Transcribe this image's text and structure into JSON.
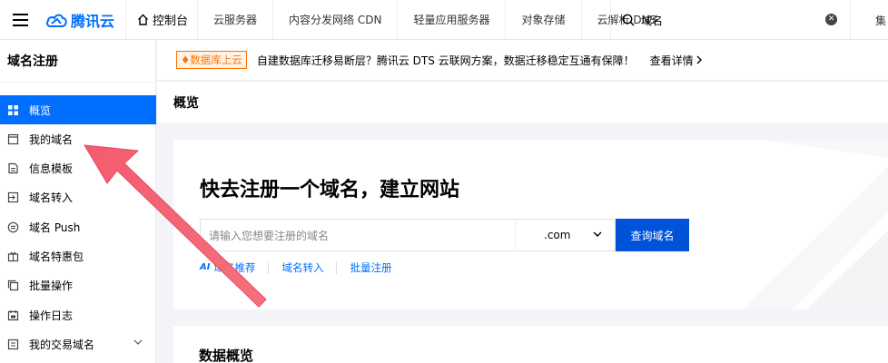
{
  "header": {
    "logo_text": "腾讯云",
    "console": "控制台",
    "nav": [
      "云服务器",
      "内容分发网络 CDN",
      "轻量应用服务器",
      "对象存储",
      "云解析 DNS"
    ],
    "search_value": "域名",
    "right_text": "集"
  },
  "sidebar": {
    "title": "域名注册",
    "items": [
      {
        "label": "概览",
        "icon": "grid-icon",
        "active": true
      },
      {
        "label": "我的域名",
        "icon": "window-icon"
      },
      {
        "label": "信息模板",
        "icon": "document-icon"
      },
      {
        "label": "域名转入",
        "icon": "transfer-icon"
      },
      {
        "label": "域名 Push",
        "icon": "push-icon"
      },
      {
        "label": "域名特惠包",
        "icon": "gift-icon"
      },
      {
        "label": "批量操作",
        "icon": "copy-icon"
      },
      {
        "label": "操作日志",
        "icon": "calendar-icon"
      },
      {
        "label": "我的交易域名",
        "icon": "trade-icon"
      }
    ]
  },
  "notice": {
    "tag": "数据库上云",
    "text": "自建数据库迁移易断层？腾讯云 DTS 云联网方案，数据迁移稳定互通有保障！",
    "link": "查看详情"
  },
  "content": {
    "header": "概览",
    "register": {
      "title": "快去注册一个域名，建立网站",
      "placeholder": "请输入您想要注册的域名",
      "tld": ".com",
      "button": "查询域名",
      "links": [
        "域名推荐",
        "域名转入",
        "批量注册"
      ]
    },
    "stats_title": "数据概览"
  },
  "colors": {
    "brand": "#006eff",
    "button": "#0052d9",
    "annotation": "#f05a6e",
    "notice_tag": "#ff7200"
  }
}
